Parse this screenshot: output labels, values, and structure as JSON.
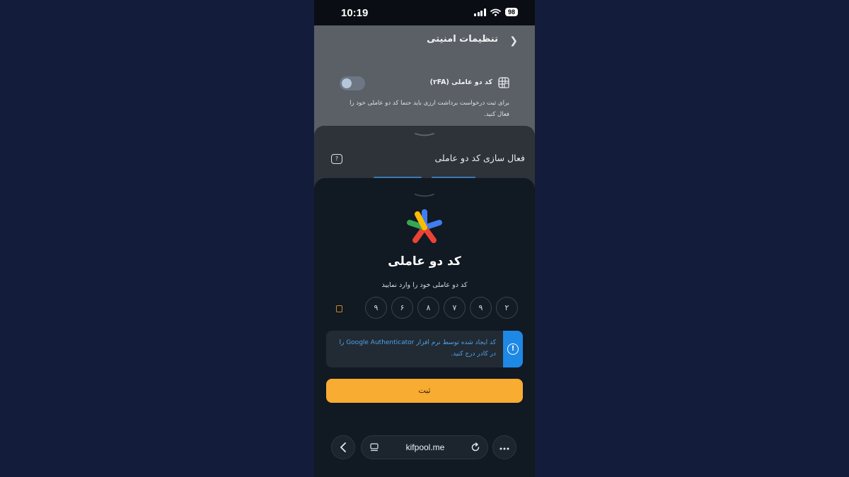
{
  "status": {
    "time": "10:19",
    "battery": "98"
  },
  "background_page": {
    "title": "تنظیمات امنیتی",
    "two_fa_label": "کد دو عاملی (۲FA)",
    "two_fa_description": "برای ثبت درخواست برداشت ارزی باید حتما کد دو عاملی خود را فعال کنید."
  },
  "middle_sheet": {
    "title": "فعال سازی کد دو عاملی"
  },
  "sheet": {
    "title": "کد دو عاملی",
    "subtitle": "کد دو عاملی خود را وارد نمایید",
    "otp_digits": [
      "۹",
      "۶",
      "۸",
      "۷",
      "۹",
      "۲"
    ],
    "info_text": "کد ایجاد شده توسط نرم افزار Google Authenticator را در کادر درج کنید.",
    "submit_label": "ثبت"
  },
  "browser": {
    "url": "kifpool.me"
  },
  "colors": {
    "accent": "#f9ac32",
    "info": "#1e88e5",
    "background": "#141c3c"
  }
}
